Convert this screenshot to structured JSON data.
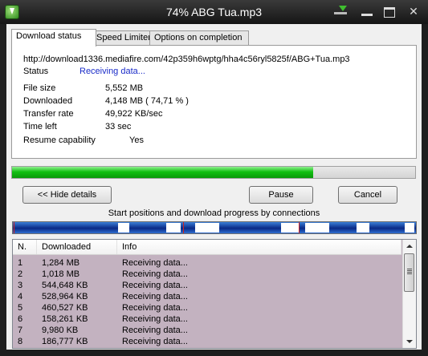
{
  "window": {
    "title": "74% ABG Tua.mp3",
    "close_glyph": "✕"
  },
  "tabs": [
    {
      "label": "Download status"
    },
    {
      "label": "Speed Limiter"
    },
    {
      "label": "Options on completion"
    }
  ],
  "status": {
    "url": "http://download1336.mediafire.com/42p359h6wptg/hha4c56ryl5825f/ABG+Tua.mp3",
    "status_label": "Status",
    "status_value": "Receiving data...",
    "file_size_label": "File size",
    "file_size": "5,552  MB",
    "downloaded_label": "Downloaded",
    "downloaded": "4,148  MB  ( 74,71 % )",
    "transfer_rate_label": "Transfer rate",
    "transfer_rate": "49,922  KB/sec",
    "time_left_label": "Time left",
    "time_left": "33 sec",
    "resume_label": "Resume capability",
    "resume": "Yes"
  },
  "progress": {
    "fraction": 0.747
  },
  "buttons": {
    "hide_details": "<< Hide details",
    "pause": "Pause",
    "cancel": "Cancel"
  },
  "connections_caption": "Start positions and download progress by connections",
  "list": {
    "columns": [
      "N.",
      "Downloaded",
      "Info"
    ],
    "rows": [
      {
        "n": "1",
        "downloaded": "1,284  MB",
        "info": "Receiving data..."
      },
      {
        "n": "2",
        "downloaded": "1,018  MB",
        "info": "Receiving data..."
      },
      {
        "n": "3",
        "downloaded": "544,648  KB",
        "info": "Receiving data..."
      },
      {
        "n": "4",
        "downloaded": "528,964  KB",
        "info": "Receiving data..."
      },
      {
        "n": "5",
        "downloaded": "460,527  KB",
        "info": "Receiving data..."
      },
      {
        "n": "6",
        "downloaded": "158,261  KB",
        "info": "Receiving data..."
      },
      {
        "n": "7",
        "downloaded": "9,980  KB",
        "info": "Receiving data..."
      },
      {
        "n": "8",
        "downloaded": "186,777  KB",
        "info": "Receiving data..."
      }
    ]
  },
  "colors": {
    "accent_green": "#12c012",
    "link_blue": "#1a2cc8",
    "row_bg": "#c3b2c0"
  }
}
